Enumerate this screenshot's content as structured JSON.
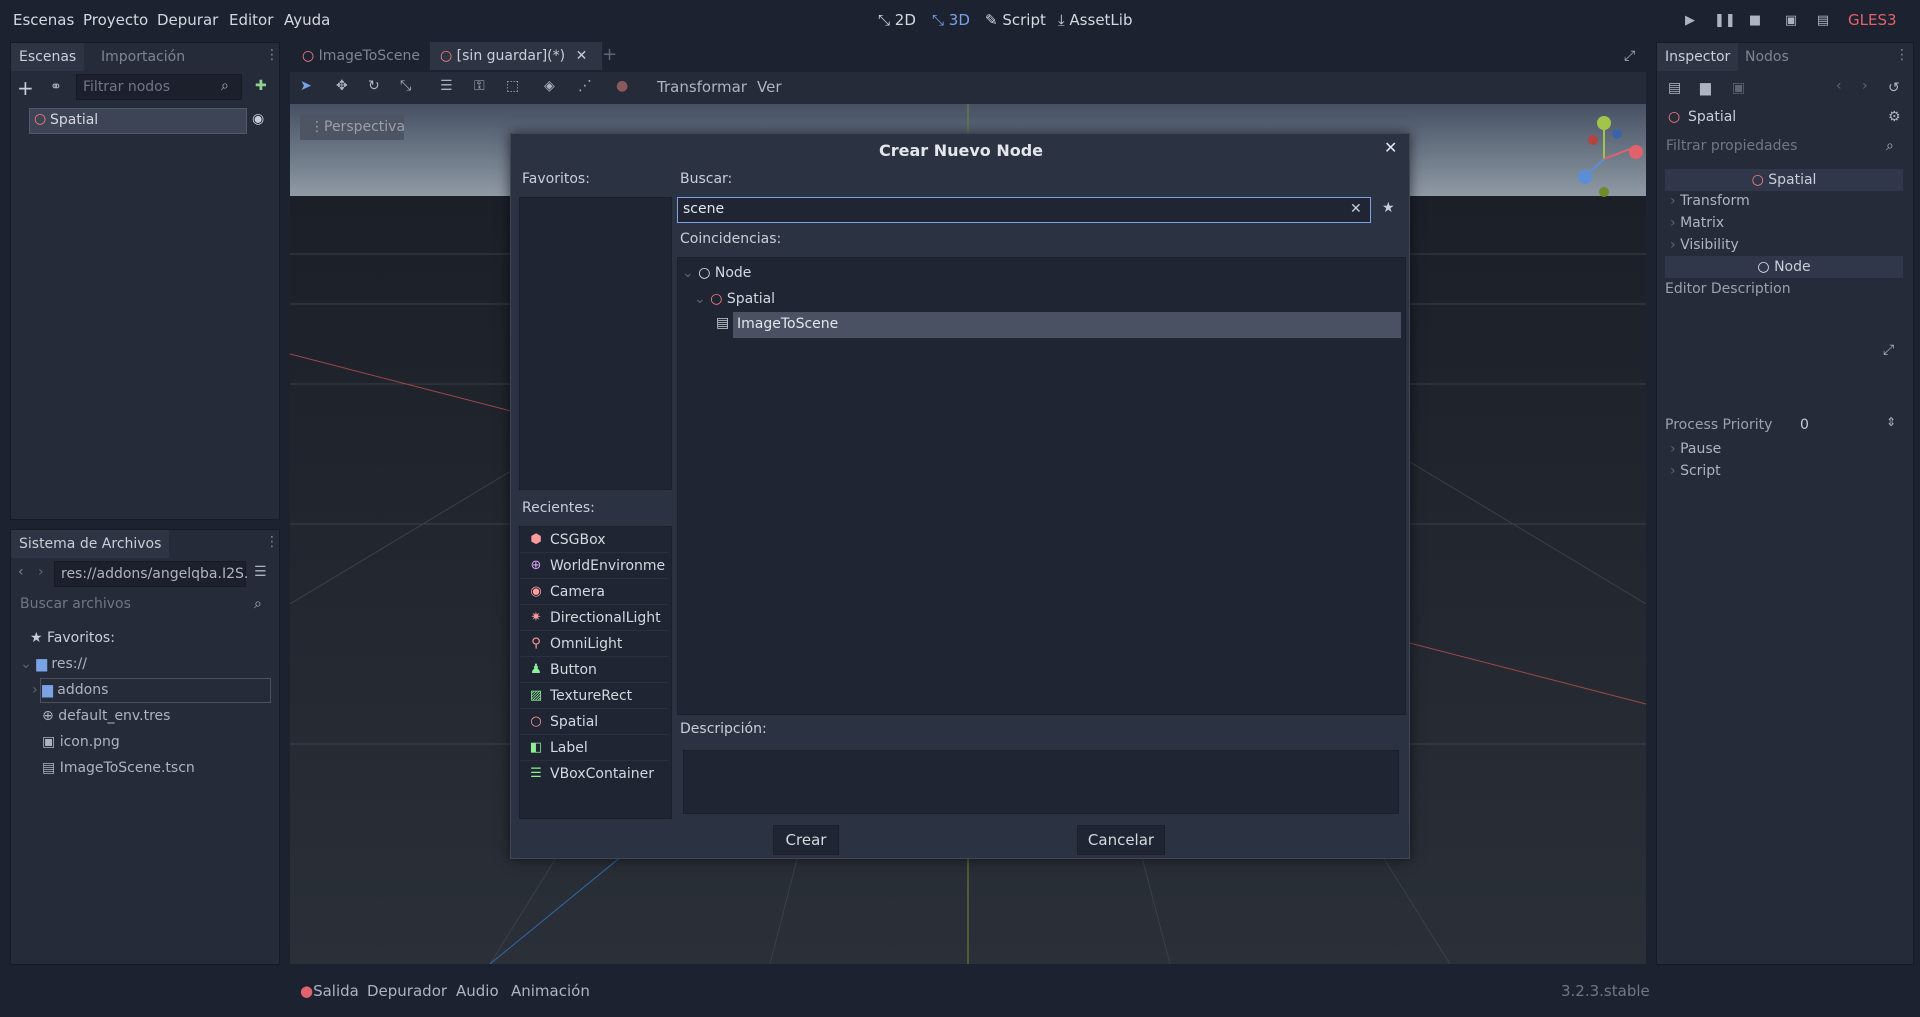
{
  "menu": [
    "Escenas",
    "Proyecto",
    "Depurar",
    "Editor",
    "Ayuda"
  ],
  "modes": {
    "m2d": "2D",
    "m3d": "3D",
    "script": "Script",
    "assetlib": "AssetLib"
  },
  "renderer": "GLES3",
  "scene_panel": {
    "tabs": [
      "Escenas",
      "Importación"
    ],
    "filter_placeholder": "Filtrar nodos",
    "root_node": "Spatial"
  },
  "editor_tabs": [
    "ImageToScene",
    "[sin guardar](*)"
  ],
  "toolbar": {
    "transform": "Transformar",
    "view": "Ver"
  },
  "viewport": {
    "perspective": "Perspectiva"
  },
  "filesystem": {
    "title": "Sistema de Archivos",
    "path": "res://addons/angelqba.I2S.",
    "search_placeholder": "Buscar archivos",
    "favorites": "Favoritos:",
    "items": [
      "res://",
      "addons",
      "default_env.tres",
      "icon.png",
      "ImageToScene.tscn"
    ]
  },
  "dialog": {
    "title": "Crear Nuevo Node",
    "favorites_label": "Favoritos:",
    "recent_label": "Recientes:",
    "recent": [
      "CSGBox",
      "WorldEnvironme",
      "Camera",
      "DirectionalLight",
      "OmniLight",
      "Button",
      "TextureRect",
      "Spatial",
      "Label",
      "VBoxContainer"
    ],
    "search_label": "Buscar:",
    "search_value": "scene",
    "matches_label": "Coincidencias:",
    "tree": [
      "Node",
      "Spatial",
      "ImageToScene"
    ],
    "description_label": "Descripción:",
    "create": "Crear",
    "cancel": "Cancelar"
  },
  "inspector": {
    "tabs": [
      "Inspector",
      "Nodos"
    ],
    "node": "Spatial",
    "filter_placeholder": "Filtrar propiedades",
    "section_spatial": "Spatial",
    "props": [
      "Transform",
      "Matrix",
      "Visibility"
    ],
    "section_node": "Node",
    "editor_description": "Editor Description",
    "process_priority_label": "Process Priority",
    "process_priority_value": "0",
    "more": [
      "Pause",
      "Script"
    ]
  },
  "bottom": {
    "output": "Salida",
    "debugger": "Depurador",
    "audio": "Audio",
    "animation": "Animación",
    "version": "3.2.3.stable"
  },
  "colors": {
    "accent": "#7aa3e6",
    "renderer": "#e0626c",
    "node_icon": "#fc7f7f"
  }
}
